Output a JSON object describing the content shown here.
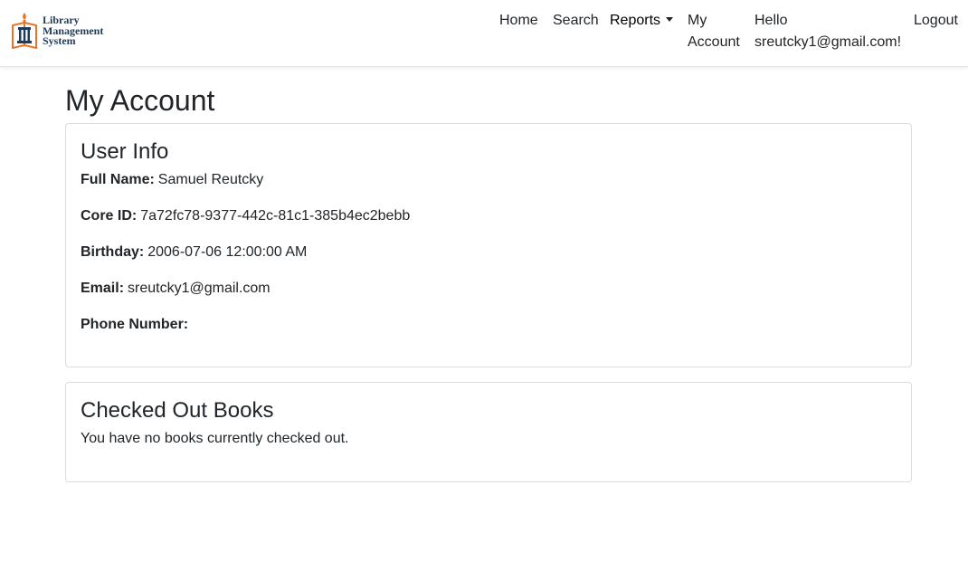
{
  "brand": {
    "line1": "Library",
    "line2": "Management",
    "line3": "System",
    "colors": {
      "flame": "#e8742a",
      "book": "#1f3b5a"
    }
  },
  "nav": {
    "home": "Home",
    "search": "Search",
    "reports": "Reports",
    "my_account_line1": "My",
    "my_account_line2": "Account",
    "hello_line1": "Hello",
    "hello_line2": "sreutcky1@gmail.com!",
    "logout": "Logout"
  },
  "page": {
    "title": "My Account"
  },
  "user_info": {
    "heading": "User Info",
    "full_name_label": "Full Name:",
    "full_name": "Samuel Reutcky",
    "core_id_label": "Core ID:",
    "core_id": "7a72fc78-9377-442c-81c1-385b4ec2bebb",
    "birthday_label": "Birthday:",
    "birthday": "2006-07-06 12:00:00 AM",
    "email_label": "Email:",
    "email": "sreutcky1@gmail.com",
    "phone_label": "Phone Number:",
    "phone": ""
  },
  "checked_out": {
    "heading": "Checked Out Books",
    "message": "You have no books currently checked out."
  }
}
